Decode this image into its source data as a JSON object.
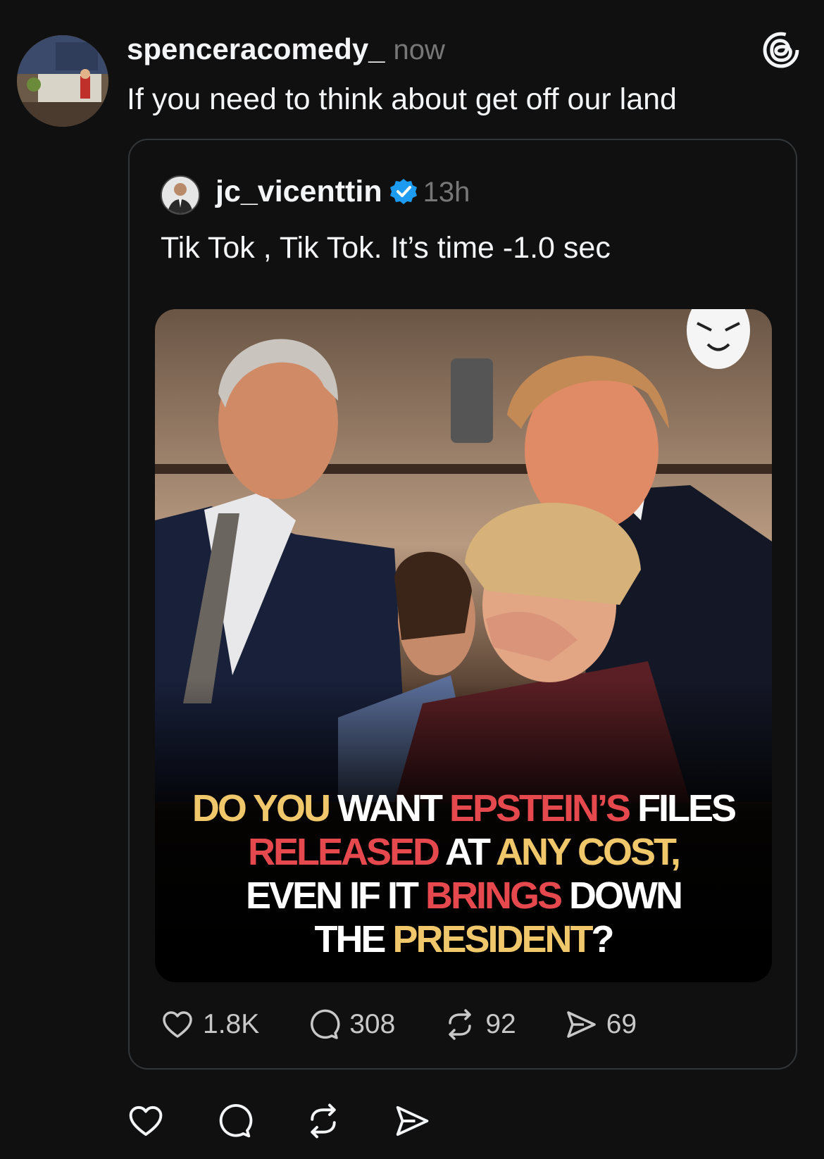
{
  "post": {
    "username": "spenceracomedy_",
    "time": "now",
    "text": "If you need to think about get off our land"
  },
  "quoted": {
    "username": "jc_vicenttin",
    "time": "13h",
    "text": "Tik Tok , Tik Tok. It’s time -1.0 sec",
    "image_caption": [
      [
        {
          "t": "DO YOU ",
          "c": "y"
        },
        {
          "t": "WANT ",
          "c": "w"
        },
        {
          "t": "EPSTEIN’S ",
          "c": "r"
        },
        {
          "t": "FILES",
          "c": "w"
        }
      ],
      [
        {
          "t": "RELEASED ",
          "c": "r"
        },
        {
          "t": "AT ",
          "c": "w"
        },
        {
          "t": "ANY COST,",
          "c": "y"
        }
      ],
      [
        {
          "t": "EVEN IF IT ",
          "c": "w"
        },
        {
          "t": "BRINGS ",
          "c": "r"
        },
        {
          "t": "DOWN",
          "c": "w"
        }
      ],
      [
        {
          "t": "THE ",
          "c": "w"
        },
        {
          "t": "PRESIDENT",
          "c": "y"
        },
        {
          "t": "?",
          "c": "w"
        }
      ]
    ],
    "stats": {
      "likes": "1.8K",
      "replies": "308",
      "reposts": "92",
      "shares": "69"
    }
  },
  "colors": {
    "background": "#101010",
    "verified": "#1d9bf0",
    "caption_yellow": "#f0c76a",
    "caption_red": "#e5484d"
  },
  "icons": [
    "threads-logo-icon",
    "verified-badge-icon",
    "heart-icon",
    "comment-icon",
    "repost-icon",
    "share-icon"
  ]
}
